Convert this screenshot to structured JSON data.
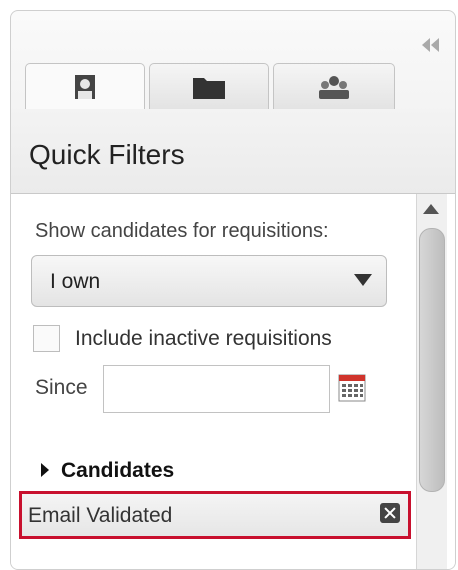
{
  "panel": {
    "collapse_icon": "double-chevron-left-icon",
    "tabs": [
      {
        "icon": "person-icon",
        "active": true
      },
      {
        "icon": "folder-icon",
        "active": false
      },
      {
        "icon": "people-group-icon",
        "active": false
      }
    ],
    "title": "Quick Filters"
  },
  "filters": {
    "show_label": "Show candidates for requisitions:",
    "requisition_select": {
      "value": "I own"
    },
    "include_inactive": {
      "label": "Include inactive requisitions",
      "checked": false
    },
    "since": {
      "label": "Since",
      "value": "",
      "calendar_icon": "calendar-icon"
    },
    "section": {
      "label": "Candidates",
      "icon": "triangle-right-icon"
    },
    "active_filter": {
      "label": "Email Validated",
      "remove_icon": "close-icon"
    }
  },
  "colors": {
    "highlight": "#c8102e"
  }
}
